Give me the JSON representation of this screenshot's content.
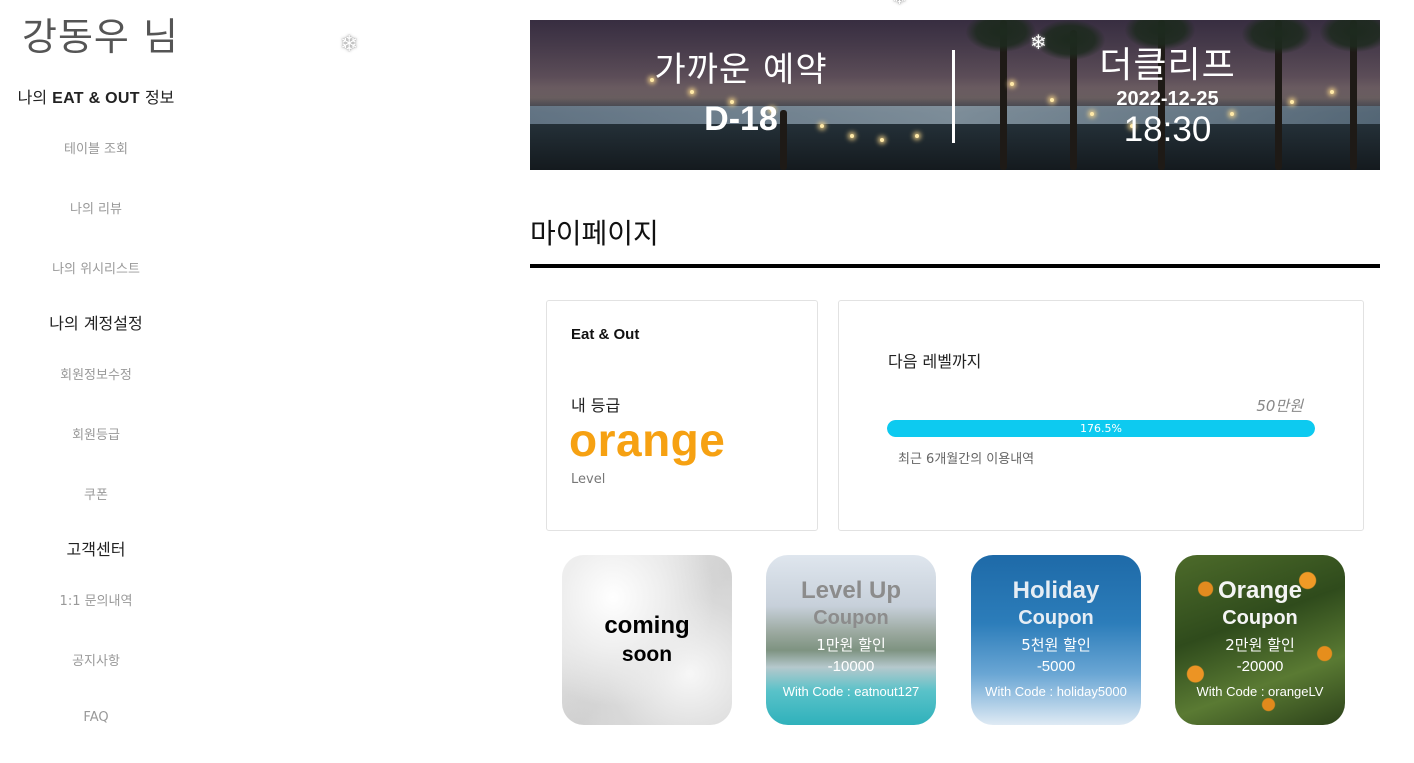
{
  "sidebar": {
    "user_name": "강동우 님",
    "section_info": {
      "prefix": "나의 ",
      "brand": "EAT & OUT",
      "suffix": " 정보"
    },
    "info_links": [
      "테이블 조회",
      "나의 리뷰",
      "나의 위시리스트"
    ],
    "section_account": "나의 계정설정",
    "account_links": [
      "회원정보수정",
      "회원등급",
      "쿠폰"
    ],
    "section_support": "고객센터",
    "support_links": [
      "1:1 문의내역",
      "공지사항",
      "FAQ"
    ]
  },
  "banner": {
    "upcoming_label": "가까운 예약",
    "d_day": "D-18",
    "restaurant": "더클리프",
    "date": "2022-12-25",
    "time": "18:30"
  },
  "page": {
    "title": "마이페이지"
  },
  "grade_card": {
    "brand": "Eat & Out",
    "label": "내 등급",
    "grade": "orange",
    "level_word": "Level",
    "grade_color": "#f6a112"
  },
  "progress_card": {
    "label": "다음 레벨까지",
    "target": "50만원",
    "percent_text": "176.5%",
    "fill_fraction": 1.0,
    "history_label": "최근 6개월간의 이용내역",
    "bar_color": "#0dcaf0"
  },
  "coupons": [
    {
      "title1": "coming",
      "title2": "soon"
    },
    {
      "title1": "Level Up",
      "title2": "Coupon",
      "desc": "1만원 할인",
      "amount": "-10000",
      "code": "With Code : eatnout127"
    },
    {
      "title1": "Holiday",
      "title2": "Coupon",
      "desc": "5천원 할인",
      "amount": "-5000",
      "code": "With Code : holiday5000"
    },
    {
      "title1": "Orange",
      "title2": "Coupon",
      "desc": "2만원 할인",
      "amount": "-20000",
      "code": "With Code : orangeLV"
    }
  ],
  "icons": {
    "decoration": "snowflake-icon"
  }
}
